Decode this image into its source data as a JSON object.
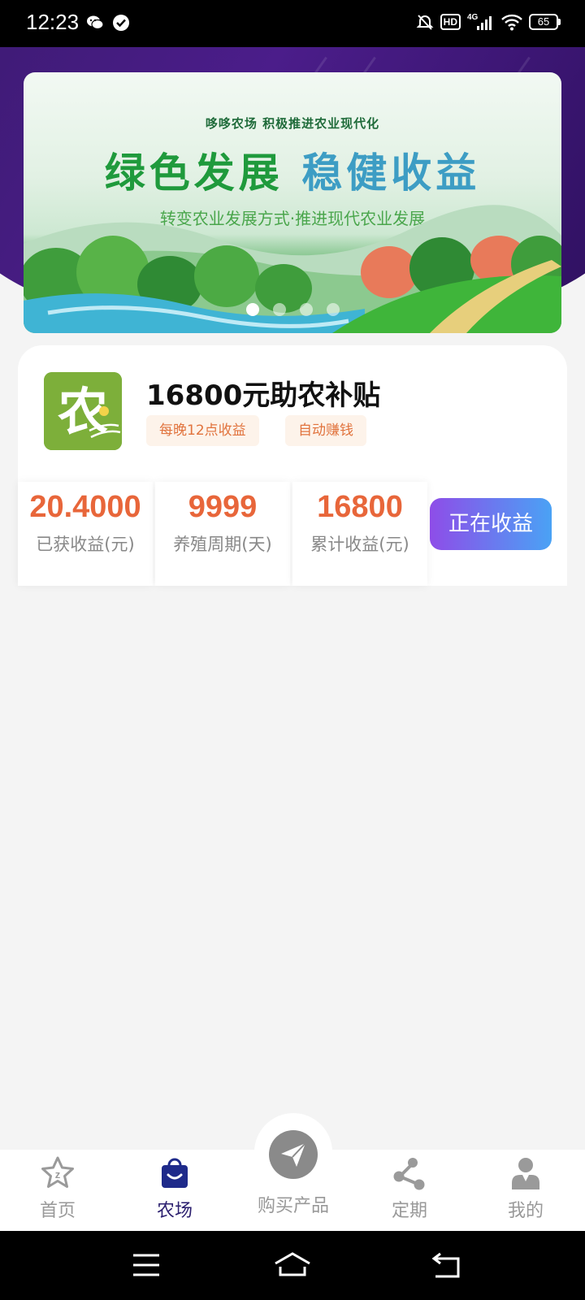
{
  "status_bar": {
    "time": "12:23",
    "left_icons": [
      "wechat-icon",
      "check-circle-icon"
    ],
    "right_icons": [
      "bell-off-icon",
      "hd-icon",
      "signal-4g-icon",
      "wifi-icon",
      "battery-icon"
    ],
    "hd_label": "HD",
    "network": "4G",
    "battery_level": "65"
  },
  "banner": {
    "subtitle": "哆哆农场  积极推进农业现代化",
    "title_green": "绿色发展 ",
    "title_blue": "稳健收益",
    "caption": "转变农业发展方式·推进现代农业发展",
    "slide_count": 4,
    "active_slide": 1
  },
  "product": {
    "logo_char": "农",
    "title": "16800元助农补贴",
    "tags": [
      "每晚12点收益",
      "自动赚钱"
    ],
    "stats": [
      {
        "value": "20.4000",
        "label": "已获收益(元)"
      },
      {
        "value": "9999",
        "label": "养殖周期(天)"
      },
      {
        "value": "16800",
        "label": "累计收益(元)"
      }
    ],
    "button_label": "正在收益"
  },
  "bottom_nav": {
    "items": [
      {
        "label": "首页",
        "icon": "star-home-icon",
        "active": false
      },
      {
        "label": "农场",
        "icon": "shopping-bag-icon",
        "active": true
      },
      {
        "label": "购买产品",
        "icon": "paper-plane-icon",
        "active": false
      },
      {
        "label": "定期",
        "icon": "share-nodes-icon",
        "active": false
      },
      {
        "label": "我的",
        "icon": "user-icon",
        "active": false
      }
    ]
  },
  "system_nav": {
    "buttons": [
      "menu-icon",
      "home-icon",
      "back-icon"
    ]
  },
  "colors": {
    "accent_orange": "#e8663a",
    "header_purple": "#4b1d8a",
    "button_gradient_start": "#8e4de8",
    "button_gradient_end": "#4aa2f5",
    "nav_active": "#2a1e6e",
    "nav_inactive": "#999999",
    "logo_green": "#7daf3a"
  }
}
